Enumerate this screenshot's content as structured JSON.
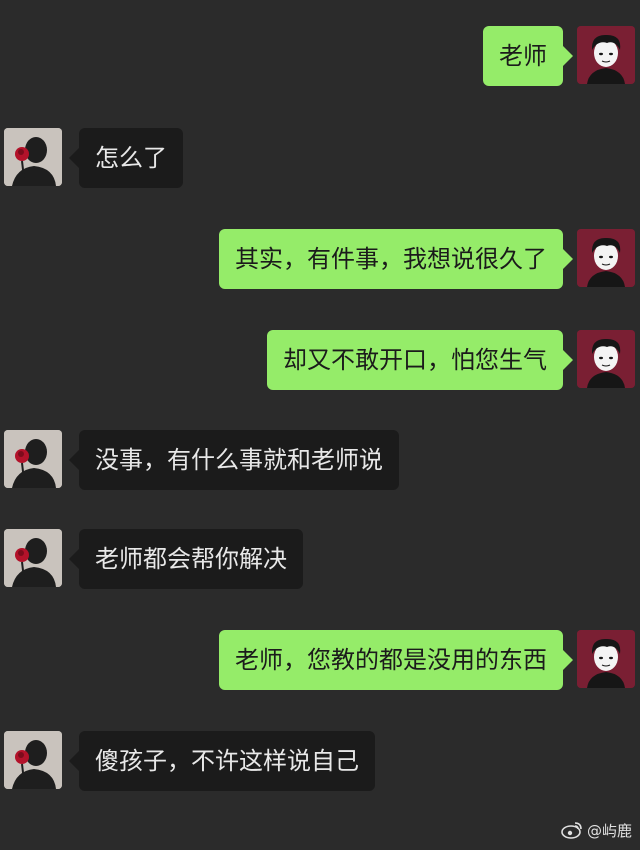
{
  "messages": [
    {
      "sender": "student",
      "text": "老师"
    },
    {
      "sender": "teacher",
      "text": "怎么了"
    },
    {
      "sender": "student",
      "text": "其实，有件事，我想说很久了"
    },
    {
      "sender": "student",
      "text": "却又不敢开口，怕您生气"
    },
    {
      "sender": "teacher",
      "text": "没事，有什么事就和老师说"
    },
    {
      "sender": "teacher",
      "text": "老师都会帮你解决"
    },
    {
      "sender": "student",
      "text": "老师，您教的都是没用的东西"
    },
    {
      "sender": "teacher",
      "text": "傻孩子，不许这样说自己"
    }
  ],
  "watermark": {
    "handle": "@屿鹿",
    "icon": "weibo-logo-icon"
  },
  "colors": {
    "background": "#2b2b2b",
    "incoming_bubble": "#1b1b1b",
    "outgoing_bubble": "#95ec69",
    "student_avatar_bg": "#7a1f33",
    "teacher_avatar_bg": "#c9c3bd"
  },
  "icons": {
    "student_avatar": "boy-avatar-icon",
    "teacher_avatar": "rose-avatar-icon"
  }
}
